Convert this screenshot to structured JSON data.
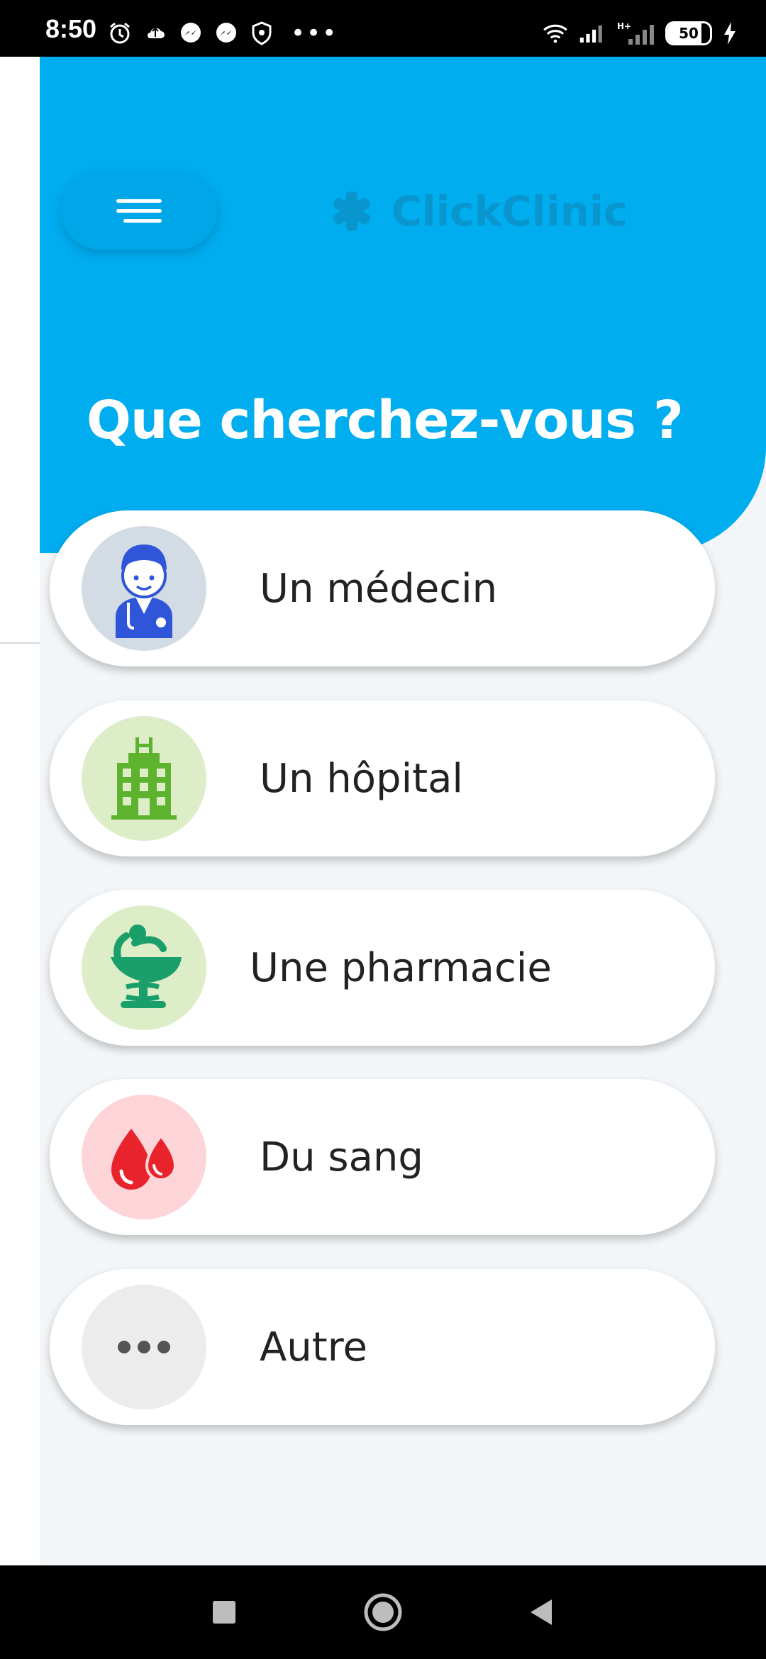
{
  "status_bar": {
    "time": "8:50",
    "battery": "50",
    "icons_left": [
      "alarm-icon",
      "cloud-upload-icon",
      "messenger-icon",
      "messenger-icon",
      "shield-icon",
      "more-dots-icon"
    ],
    "icons_right": [
      "wifi-icon",
      "signal-icon",
      "signal-h-plus-icon",
      "battery-icon",
      "charging-bolt-icon"
    ],
    "network_label": "H+"
  },
  "header": {
    "brand_name": "ClickClinic",
    "title": "Que cherchez-vous ?"
  },
  "options": [
    {
      "label": "Un médecin",
      "icon": "doctor-icon",
      "icon_bg": "#d3dbe4"
    },
    {
      "label": "Un hôpital",
      "icon": "hospital-icon",
      "icon_bg": "#dcedc8"
    },
    {
      "label": "Une pharmacie",
      "icon": "pharmacy-icon",
      "icon_bg": "#dcedc8"
    },
    {
      "label": "Du sang",
      "icon": "blood-drops-icon",
      "icon_bg": "#fdd5d8"
    },
    {
      "label": "Autre",
      "icon": "more-dots-icon",
      "icon_bg": "#ececec"
    }
  ],
  "colors": {
    "primary": "#00adef",
    "background": "#f3f6f8",
    "card": "#ffffff",
    "text": "#222222"
  },
  "nav_bar": [
    "recent-apps-button",
    "home-button",
    "back-button"
  ]
}
